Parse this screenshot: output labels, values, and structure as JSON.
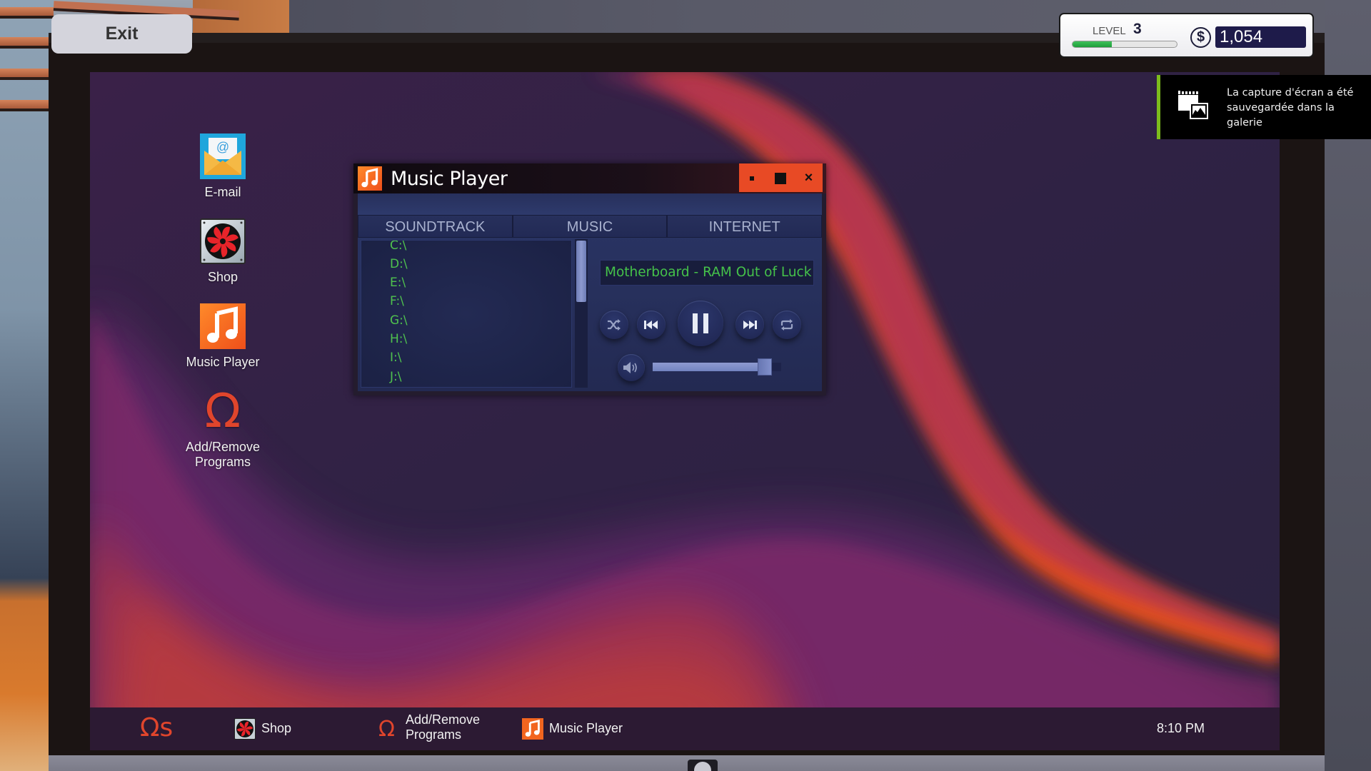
{
  "hud": {
    "exit_label": "Exit",
    "level_label": "LEVEL",
    "level_value": "3",
    "level_progress": 0.38,
    "currency_symbol": "$",
    "money": "1,054"
  },
  "notification": {
    "icon": "screenshot-gallery-icon",
    "text": "La capture d'écran a été sauvegardée dans la galerie",
    "accent_color": "#7cbc1c"
  },
  "desktop": {
    "icons": [
      {
        "label": "E-mail",
        "icon": "email-icon"
      },
      {
        "label": "Shop",
        "icon": "fan-shop-icon"
      },
      {
        "label": "Music Player",
        "icon": "music-note-icon"
      },
      {
        "label": "Add/Remove Programs",
        "icon": "omega-icon"
      }
    ]
  },
  "music_player": {
    "title": "Music Player",
    "window_buttons": {
      "minimize": "minimize",
      "maximize": "maximize",
      "close": "×"
    },
    "tabs": [
      {
        "label": "SOUNDTRACK"
      },
      {
        "label": "MUSIC"
      },
      {
        "label": "INTERNET"
      }
    ],
    "drives": [
      "C:\\",
      "D:\\",
      "E:\\",
      "F:\\",
      "G:\\",
      "H:\\",
      "I:\\",
      "J:\\"
    ],
    "now_playing": "Motherboard - RAM Out of Luck",
    "controls": [
      "shuffle",
      "previous",
      "pause",
      "next",
      "repeat"
    ],
    "volume": 0.92,
    "accent_color": "#e84a25",
    "text_color": "#4fc24e"
  },
  "taskbar": {
    "start_label": "Ωs",
    "items": [
      {
        "label": "Shop",
        "icon": "fan-shop-icon"
      },
      {
        "label": "Add/Remove Programs",
        "label_line1": "Add/Remove",
        "label_line2": "Programs",
        "icon": "omega-icon"
      },
      {
        "label": "Music Player",
        "icon": "music-note-icon"
      }
    ],
    "clock": "8:10 PM"
  }
}
